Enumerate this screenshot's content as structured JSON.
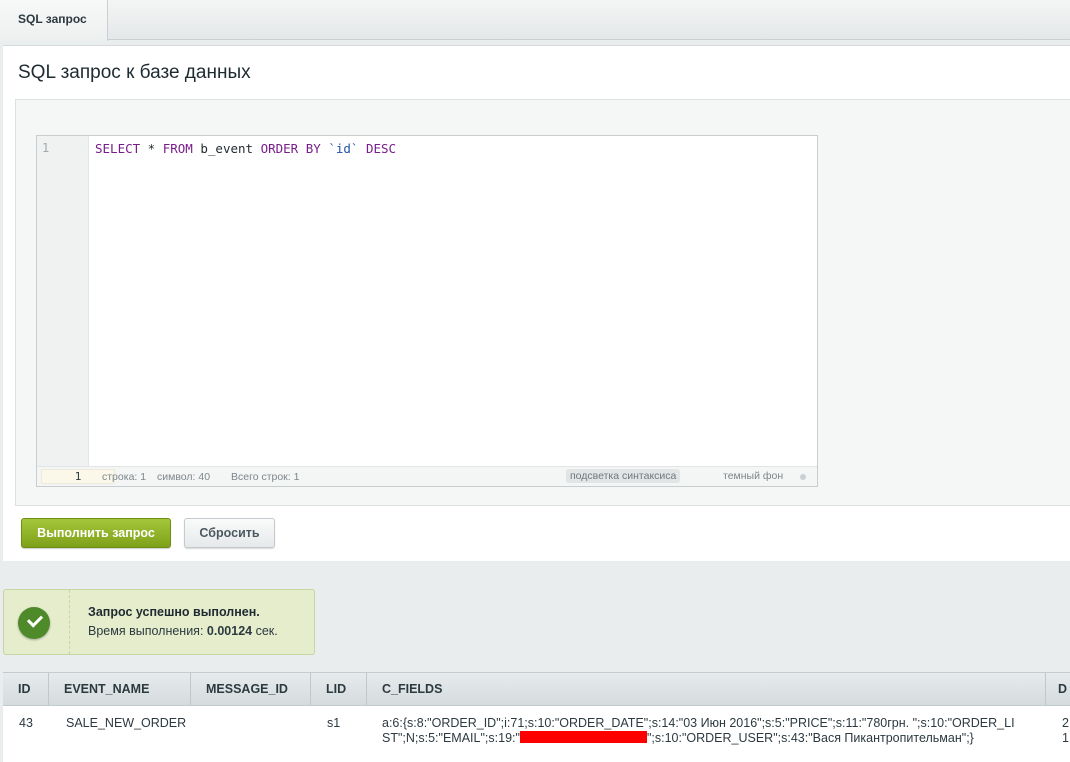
{
  "tabs": [
    {
      "label": "SQL запрос"
    }
  ],
  "page": {
    "title": "SQL запрос к базе данных"
  },
  "editor": {
    "line_number": "1",
    "code_tokens": {
      "select": "SELECT",
      "star": " * ",
      "from": "FROM",
      "table": " b_event ",
      "order": "ORDER",
      "by": "BY",
      "col": "`id`",
      "desc": "DESC"
    },
    "status": {
      "current_line": "1",
      "position": "строка: 1",
      "column": "символ: 40",
      "total": "Всего строк: 1",
      "highlight": "подсветка синтаксиса",
      "dark": "темный фон"
    }
  },
  "buttons": {
    "run": "Выполнить запрос",
    "reset": "Сбросить"
  },
  "message": {
    "title": "Запрос успешно выполнен.",
    "time_label": "Время выполнения:",
    "time_value": "0.00124",
    "time_unit": "сек."
  },
  "table": {
    "columns": [
      "ID",
      "EVENT_NAME",
      "MESSAGE_ID",
      "LID",
      "C_FIELDS",
      "D"
    ],
    "rows": [
      {
        "id": "43",
        "event_name": "SALE_NEW_ORDER",
        "message_id": "",
        "lid": "s1",
        "c_fields_part1": "a:6:{s:8:\"ORDER_ID\";i:71;s:10:\"ORDER_DATE\";s:14:\"03 Июн 2016\";s:5:\"PRICE\";s:11:\"780грн. \";s:10:\"ORDER_LIST\";N;s:5:\"EMAIL\";s:19:\"",
        "c_fields_part2": "\";s:10:\"ORDER_USER\";s:43:\"Вася Пикантропительман\";}",
        "extra": "2",
        "extra2": "1"
      }
    ]
  },
  "colors": {
    "accent_green": "#8bb024",
    "success_bg": "#e5edcc",
    "redaction": "#ff0000"
  }
}
